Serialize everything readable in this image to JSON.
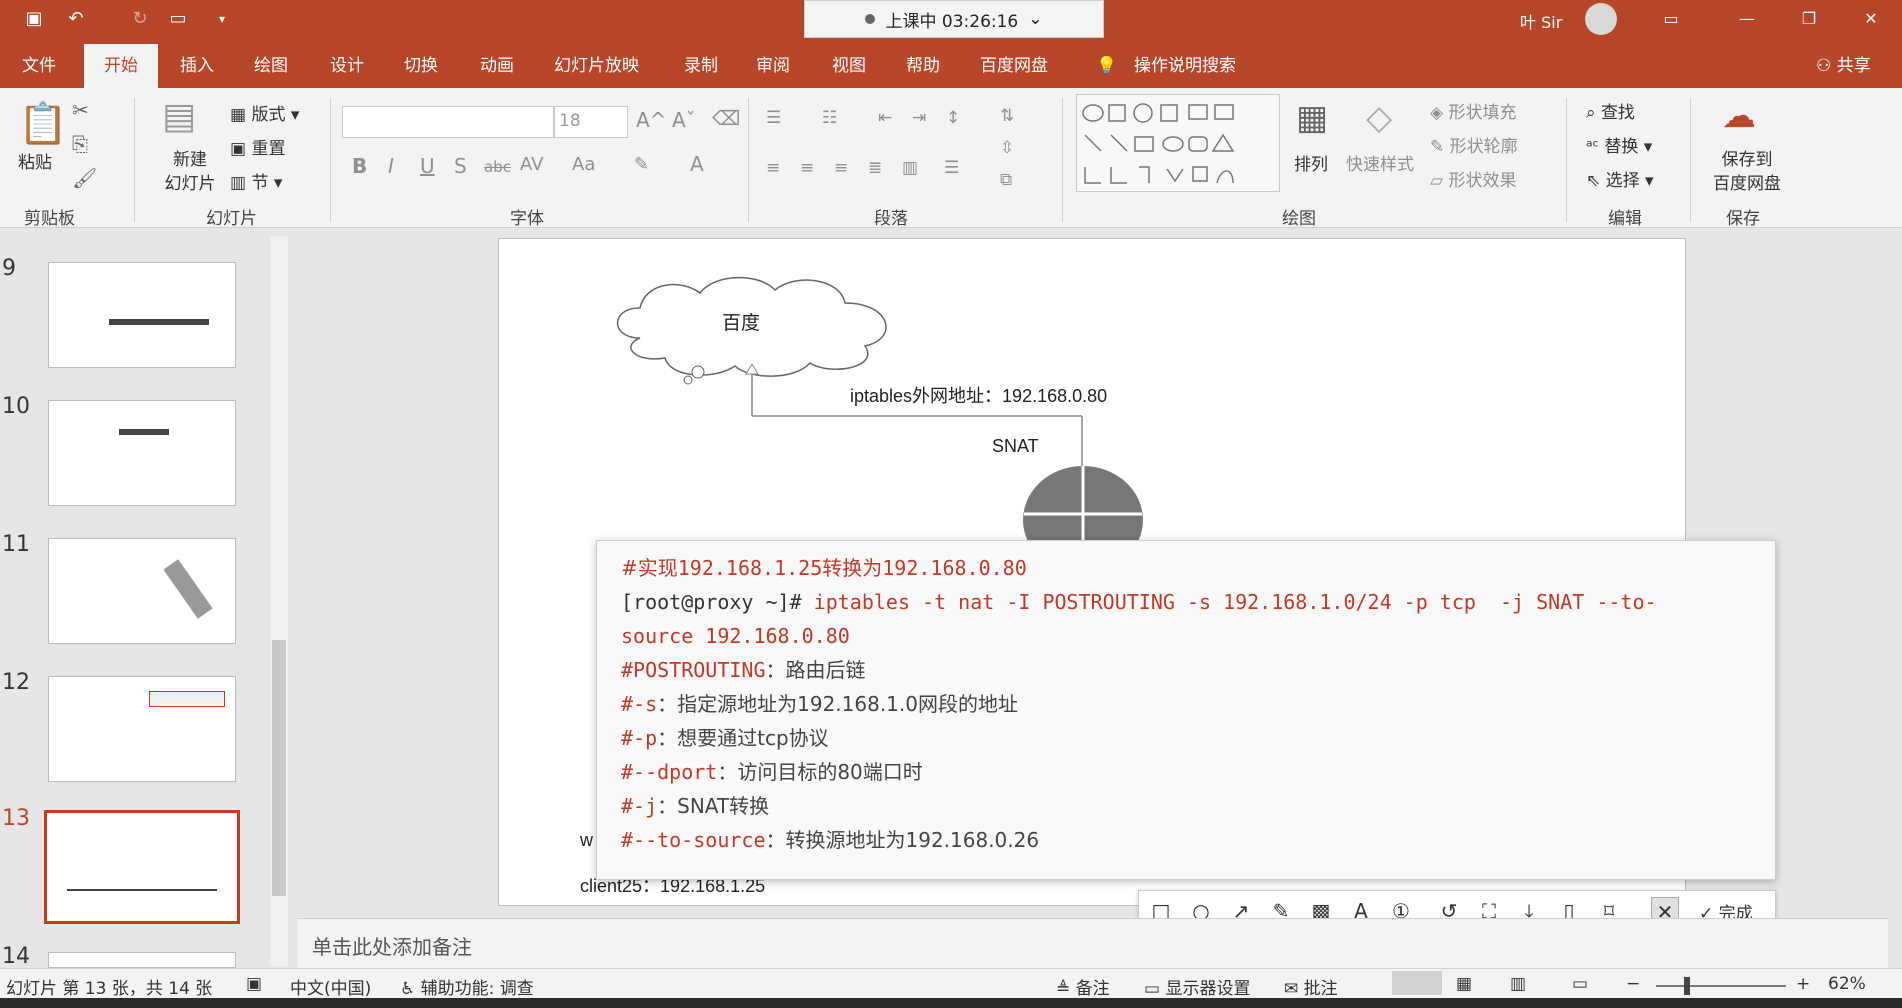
{
  "titlebar": {
    "timer": "上课中 03:26:16",
    "user": "叶 Sir"
  },
  "menu": {
    "items": [
      "文件",
      "开始",
      "插入",
      "绘图",
      "设计",
      "切换",
      "动画",
      "幻灯片放映",
      "录制",
      "审阅",
      "视图",
      "帮助",
      "百度网盘"
    ],
    "search": "操作说明搜索",
    "share": "共享"
  },
  "ribbon": {
    "paste": "粘贴",
    "new_slide": "新建\n幻灯片",
    "layout": "版式",
    "reset": "重置",
    "section": "节",
    "font_size": "18",
    "arrange": "排列",
    "quick_styles": "快速样式",
    "shape_fill": "形状填充",
    "shape_outline": "形状轮廓",
    "shape_effects": "形状效果",
    "find": "查找",
    "replace": "替换",
    "select": "选择",
    "save_to": "保存到\n百度网盘",
    "groups": {
      "clipboard": "剪贴板",
      "slides": "幻灯片",
      "font": "字体",
      "paragraph": "段落",
      "drawing": "绘图",
      "editing": "编辑",
      "save": "保存"
    }
  },
  "thumbnails": [
    {
      "num": "9"
    },
    {
      "num": "10"
    },
    {
      "num": "11"
    },
    {
      "num": "12"
    },
    {
      "num": "13",
      "active": true
    },
    {
      "num": "14"
    }
  ],
  "slide": {
    "cloud_label": "百度",
    "wan_label": "iptables外网地址：192.168.0.80",
    "snat_label": "SNAT",
    "w_label": "w",
    "client_label": "client25：192.168.1.25"
  },
  "code": {
    "lines": [
      {
        "prefix": "#实现",
        "rest": "192.168.1.25转换为192.168.0.80"
      },
      {
        "prefix": "[root@proxy ~]#",
        "rest": " iptables -t nat -I POSTROUTING -s 192.168.1.0/24 -p tcp  -j SNAT --to-"
      },
      {
        "prefix": "",
        "rest": "source 192.168.0.80"
      },
      {
        "prefix": "#POSTROUTING",
        "rest": "：路由后链"
      },
      {
        "prefix": "#-s",
        "rest": "：指定源地址为192.168.1.0网段的地址"
      },
      {
        "prefix": "#-p",
        "rest": "：想要通过tcp协议"
      },
      {
        "prefix": "#--dport",
        "rest": "：访问目标的80端口时"
      },
      {
        "prefix": "#-j",
        "rest": "：SNAT转换"
      },
      {
        "prefix": "#--to-source",
        "rest": "：转换源地址为192.168.0.26"
      }
    ]
  },
  "annot_toolbar": {
    "done": "完成"
  },
  "notes": {
    "placeholder": "单击此处添加备注"
  },
  "status": {
    "slide_info": "幻灯片 第 13 张，共 14 张",
    "lang": "中文(中国)",
    "accessibility": "辅助功能: 调查",
    "notes": "备注",
    "display": "显示器设置",
    "comments": "批注",
    "zoom": "62%"
  },
  "colors": {
    "accent": "#b7472a",
    "active_thumb": "#c43e1c",
    "code_red": "#c0392b"
  }
}
